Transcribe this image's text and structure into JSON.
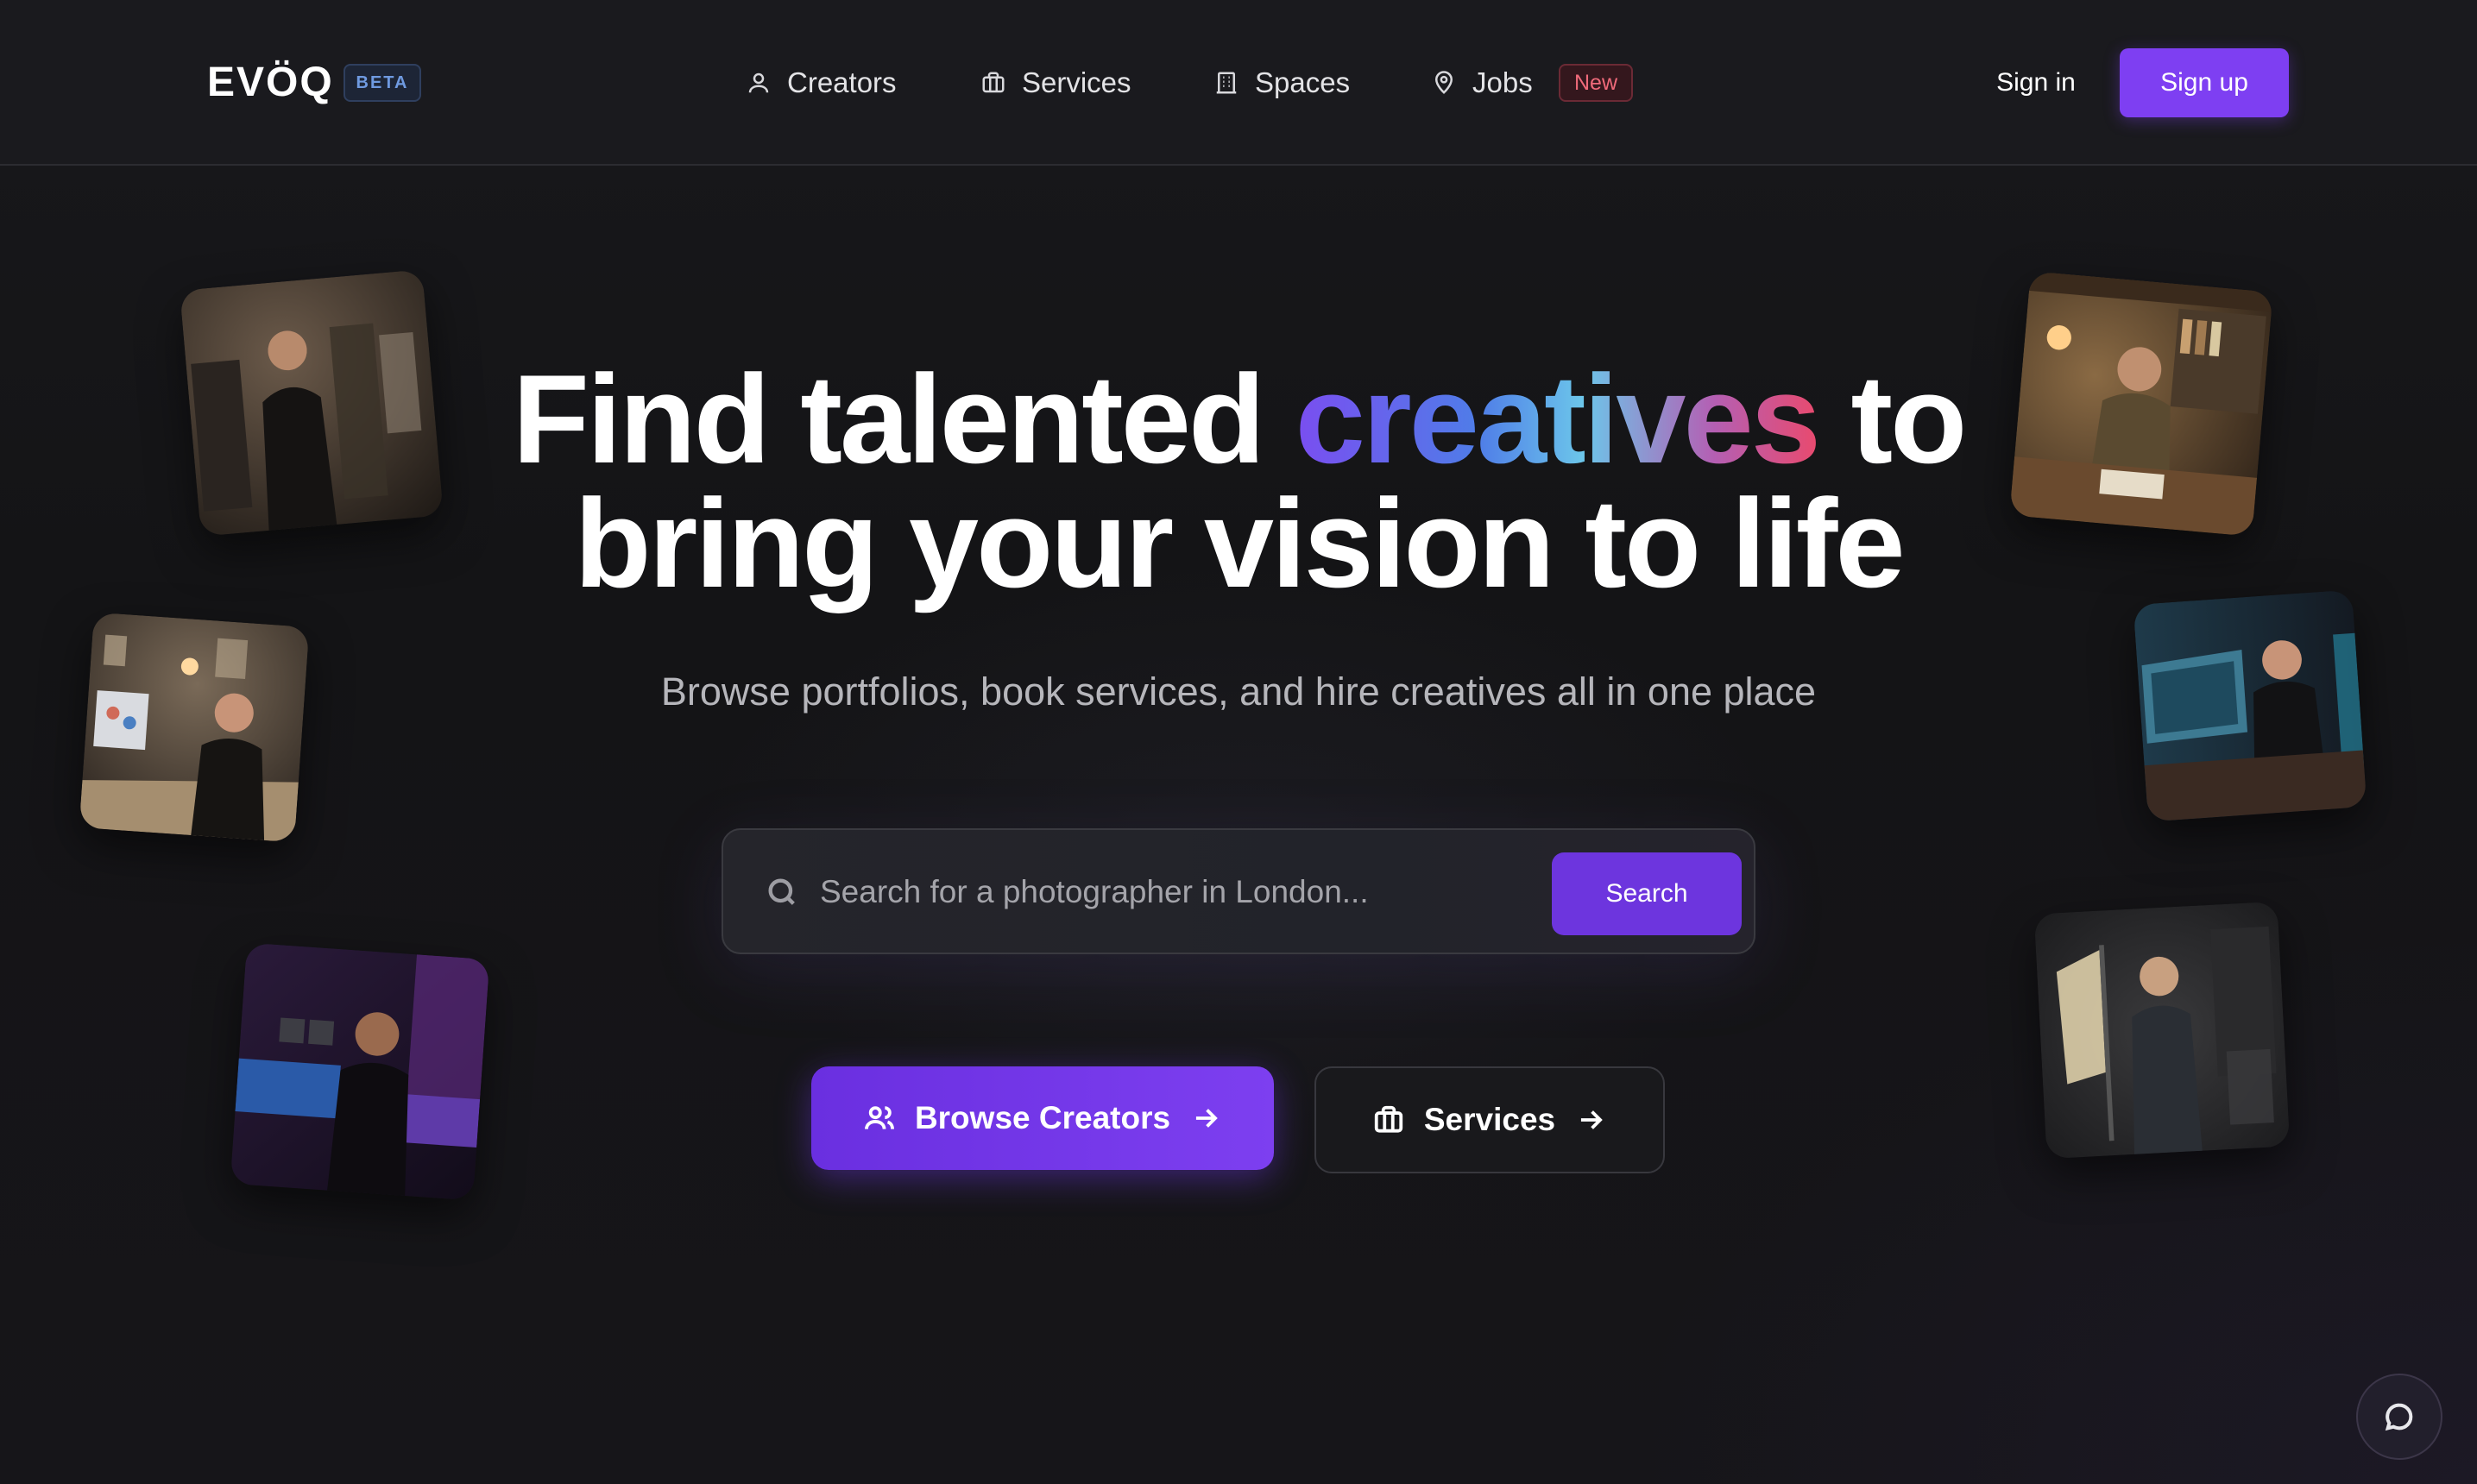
{
  "header": {
    "logo": "EVÖQ",
    "beta_badge": "BETA",
    "nav": [
      {
        "label": "Creators",
        "icon": "user-icon"
      },
      {
        "label": "Services",
        "icon": "briefcase-icon"
      },
      {
        "label": "Spaces",
        "icon": "building-icon"
      },
      {
        "label": "Jobs",
        "icon": "map-pin-icon"
      }
    ],
    "jobs_badge": "New",
    "signin_label": "Sign in",
    "signup_label": "Sign up"
  },
  "hero": {
    "title_pre": "Find talented ",
    "title_highlight": "creatives",
    "title_post": " to",
    "title_line2": "bring your vision to life",
    "subtitle": "Browse portfolios, book services, and hire creatives all in one place"
  },
  "search": {
    "placeholder": "Search for a photographer in London...",
    "button_label": "Search"
  },
  "cta": {
    "primary_label": "Browse Creators",
    "secondary_label": "Services"
  },
  "photos": [
    "fashion-designer-photo",
    "graphic-designer-photo",
    "music-producer-photo",
    "illustrator-photo",
    "video-editor-photo",
    "photographer-photo"
  ],
  "colors": {
    "background": "#141416",
    "accent": "#7e3ff2",
    "new_badge": "#ef6a7a",
    "beta_badge": "#6f9ae0"
  }
}
